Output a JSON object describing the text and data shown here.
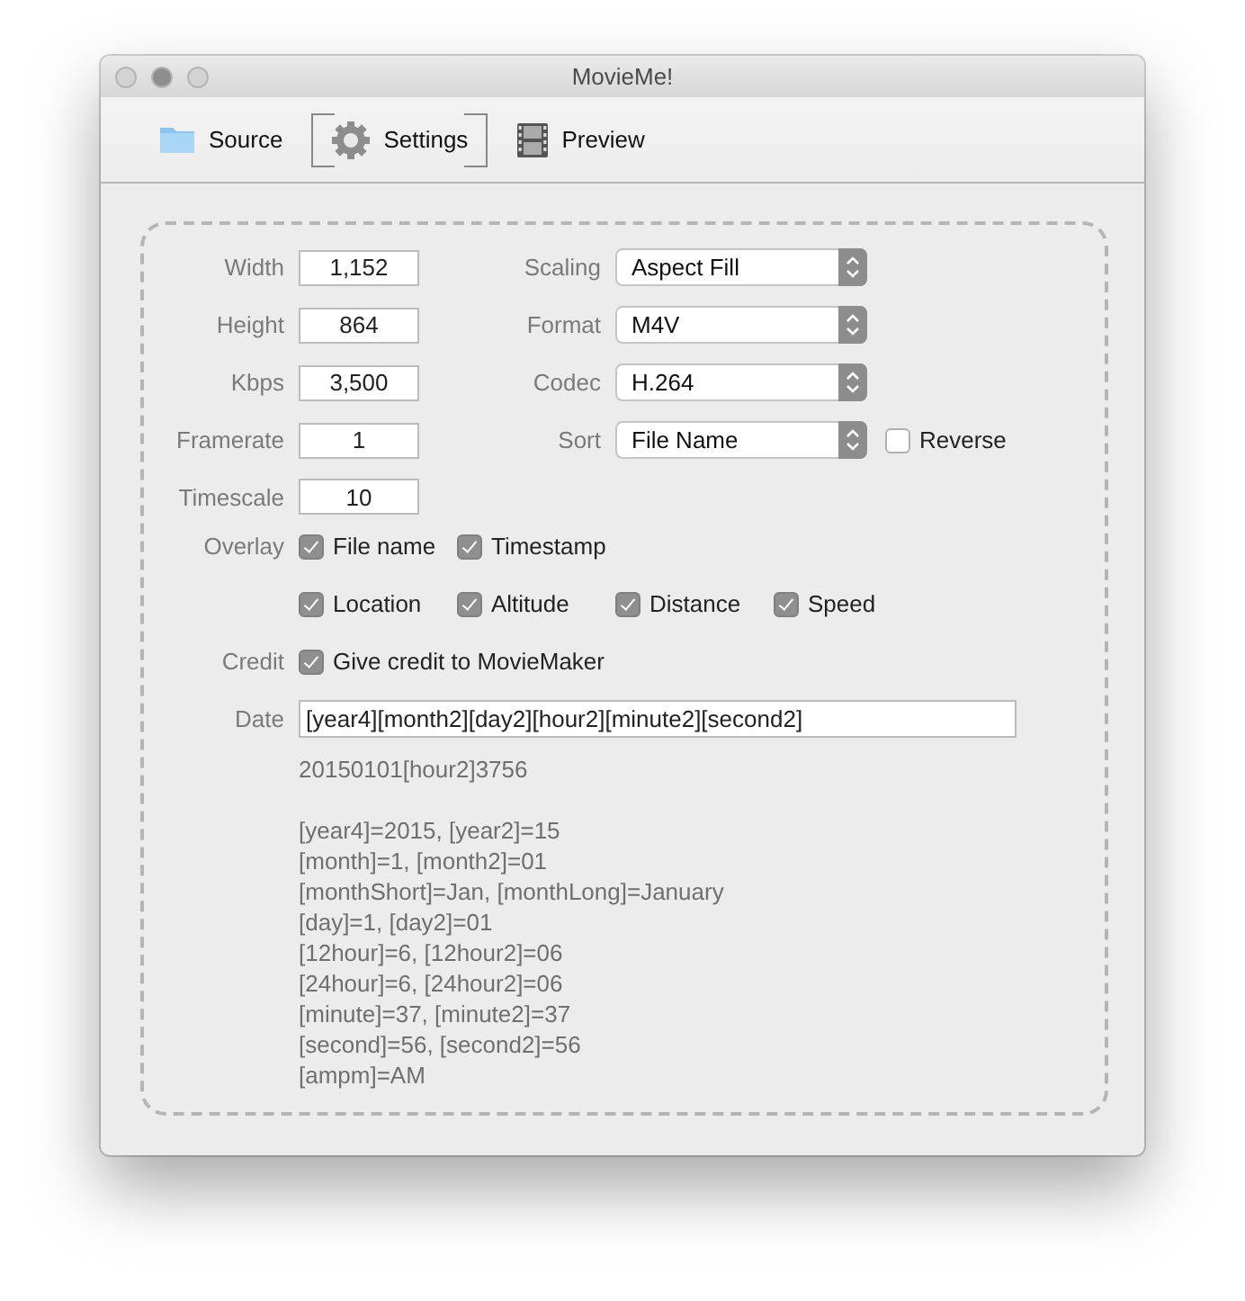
{
  "window": {
    "title": "MovieMe!"
  },
  "toolbar": [
    {
      "label": "Source",
      "kind": "folder",
      "selected": false
    },
    {
      "label": "Settings",
      "kind": "gear",
      "selected": true
    },
    {
      "label": "Preview",
      "kind": "film",
      "selected": false
    }
  ],
  "fields": [
    {
      "label": "Width",
      "value": "1,152"
    },
    {
      "label": "Height",
      "value": "864"
    },
    {
      "label": "Kbps",
      "value": "3,500"
    },
    {
      "label": "Framerate",
      "value": "1"
    },
    {
      "label": "Timescale",
      "value": "10"
    }
  ],
  "popups": [
    {
      "label": "Scaling",
      "value": "Aspect Fill"
    },
    {
      "label": "Format",
      "value": "M4V"
    },
    {
      "label": "Codec",
      "value": "H.264"
    },
    {
      "label": "Sort",
      "value": "File Name"
    }
  ],
  "reverse": {
    "label": "Reverse",
    "checked": false
  },
  "overlay": {
    "label": "Overlay",
    "rows": [
      [
        {
          "label": "File name",
          "checked": true
        },
        {
          "label": "Timestamp",
          "checked": true
        }
      ],
      [
        {
          "label": "Location",
          "checked": true
        },
        {
          "label": "Altitude",
          "checked": true
        },
        {
          "label": "Distance",
          "checked": true
        },
        {
          "label": "Speed",
          "checked": true
        }
      ]
    ]
  },
  "credit": {
    "label": "Credit",
    "option": {
      "label": "Give credit to MovieMaker",
      "checked": true
    }
  },
  "date": {
    "label": "Date",
    "value": "[year4][month2][day2][hour2][minute2][second2]"
  },
  "preview": "20150101[hour2]3756",
  "legend": [
    "[year4]=2015, [year2]=15",
    "[month]=1, [month2]=01",
    "[monthShort]=Jan, [monthLong]=January",
    "[day]=1, [day2]=01",
    "[12hour]=6, [12hour2]=06",
    "[24hour]=6, [24hour2]=06",
    "[minute]=37, [minute2]=37",
    "[second]=56, [second2]=56",
    "[ampm]=AM"
  ]
}
